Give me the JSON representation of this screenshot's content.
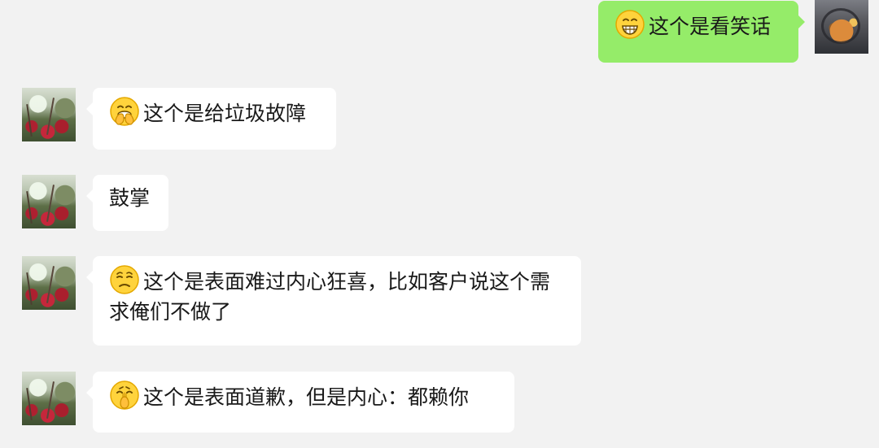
{
  "messages": [
    {
      "id": "m1",
      "side": "self",
      "emoji": "grinning-face-icon",
      "text": "这个是看笑话"
    },
    {
      "id": "m2",
      "side": "other",
      "emoji": "face-with-hand-over-mouth-icon",
      "text": "这个是给垃圾故障"
    },
    {
      "id": "m3",
      "side": "other",
      "emoji": "",
      "text": "鼓掌"
    },
    {
      "id": "m4",
      "side": "other",
      "emoji": "pensive-face-icon",
      "text": "这个是表面难过内心狂喜，比如客户说这个需求俺们不做了"
    },
    {
      "id": "m5",
      "side": "other",
      "emoji": "hand-over-mouth-shy-face-icon",
      "text": "这个是表面道歉，但是内心：都赖你"
    }
  ],
  "colors": {
    "background": "#f2f2f2",
    "incoming_bubble": "#ffffff",
    "outgoing_bubble": "#95ec69",
    "text": "#191919"
  }
}
